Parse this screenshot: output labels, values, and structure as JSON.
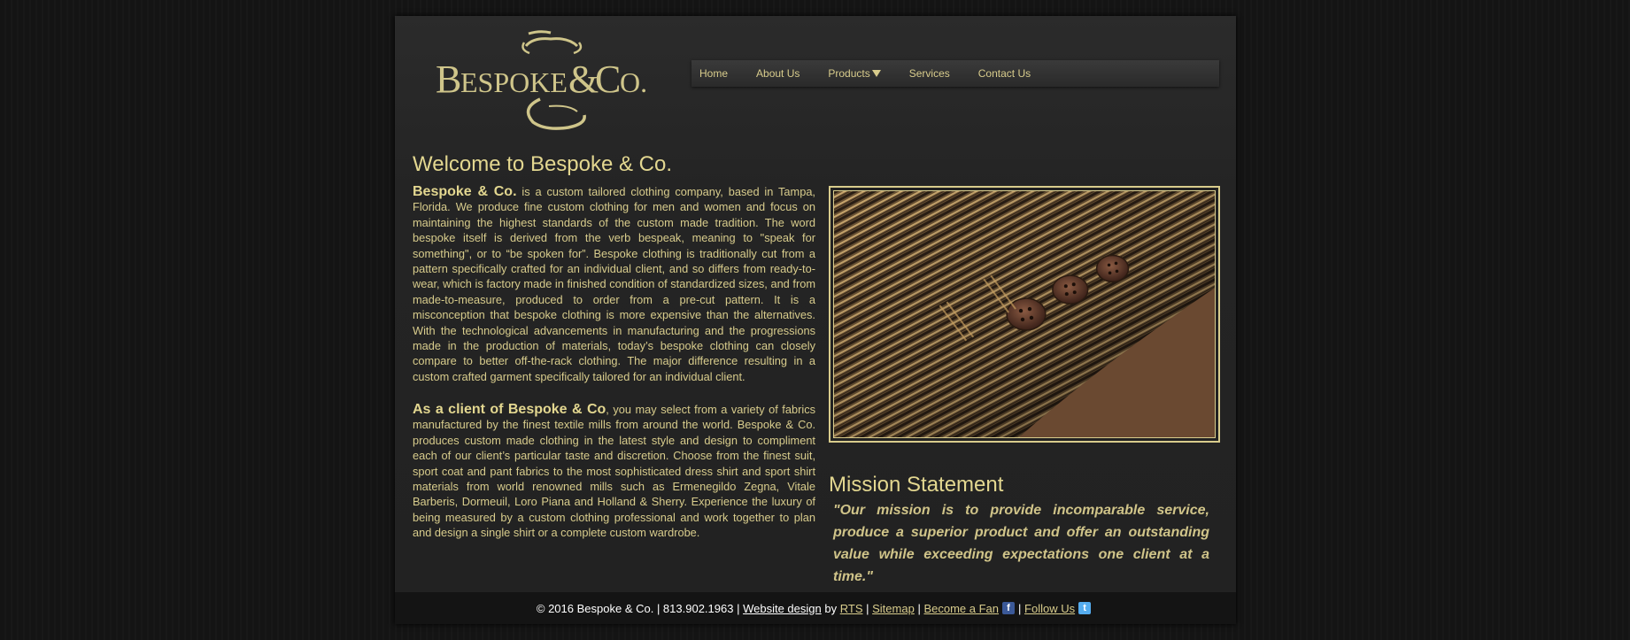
{
  "brand": {
    "logo_text": "Bespoke & Co."
  },
  "nav": {
    "items": [
      {
        "label": "Home"
      },
      {
        "label": "About Us"
      },
      {
        "label": "Products",
        "has_dropdown": true
      },
      {
        "label": "Services"
      },
      {
        "label": "Contact Us"
      }
    ]
  },
  "welcome": {
    "title": "Welcome to Bespoke & Co.",
    "p1_lead": "Bespoke & Co.",
    "p1_text": " is a custom tailored clothing company, based in Tampa, Florida. We produce fine custom clothing for men and women and focus on maintaining the highest standards of the custom made tradition. The word bespoke itself is derived from the verb bespeak, meaning to \"speak for something\", or to “be spoken for”. Bespoke clothing is traditionally cut from a pattern specifically crafted for an individual client, and so differs from ready-to-wear, which is factory made in finished condition of standardized sizes, and from made-to-measure, produced to order from a pre-cut pattern. It is a misconception that bespoke clothing is more expensive than the alternatives. With the technological advancements in manufacturing and the progressions made in the production of materials, today’s bespoke clothing can closely compare to better off-the-rack clothing. The major difference resulting in a custom crafted garment specifically tailored for an individual client.",
    "p2_lead": "As a client of Bespoke & Co",
    "p2_text": ", you may select from a variety of fabrics manufactured by the finest textile mills from around the world. Bespoke & Co. produces custom made clothing in the latest style and design to compliment each of our client’s particular taste and discretion. Choose from the finest suit, sport coat and pant fabrics to the most sophisticated dress shirt and sport shirt materials from world renowned mills such as Ermenegildo Zegna, Vitale Barberis, Dormeuil, Loro Piana and Holland & Sherry. Experience the luxury of being measured by a custom clothing professional and work together to plan and design a single shirt or a complete custom wardrobe."
  },
  "mission": {
    "title": "Mission Statement",
    "quote": "\"Our mission is to provide incomparable service, produce a superior product and offer an outstanding value while exceeding expectations one client at a time.\""
  },
  "footer": {
    "copyright": "© 2016 Bespoke & Co. | 813.902.1963 |",
    "website_design": "Website design",
    "by": "by",
    "rts": "RTS",
    "sep": "|",
    "sitemap": "Sitemap",
    "become_fan": "Become a Fan",
    "follow_us": "Follow Us",
    "fb_icon": "facebook-icon",
    "tw_icon": "twitter-icon"
  },
  "colors": {
    "gold": "#d8cc8c",
    "background": "#161616",
    "panel": "#252525"
  }
}
